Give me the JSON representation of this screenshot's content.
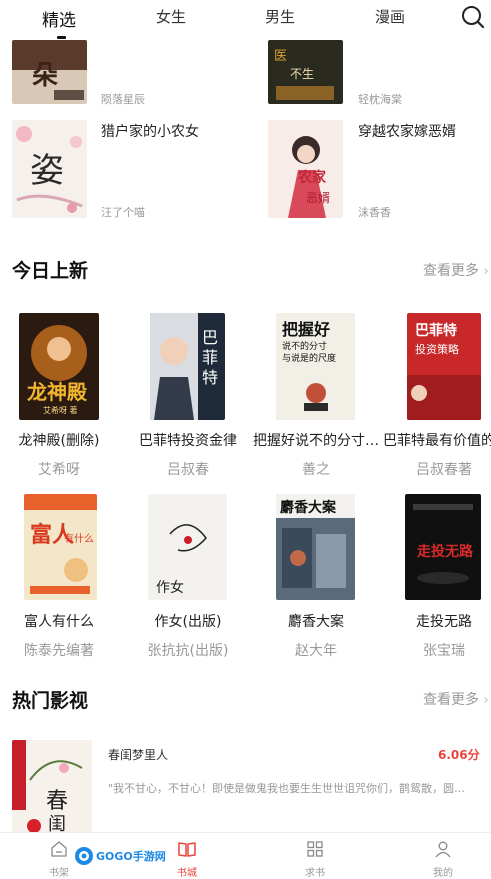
{
  "top_tabs": [
    {
      "label": "精选"
    },
    {
      "label": "女生"
    },
    {
      "label": "男生"
    },
    {
      "label": "漫画"
    }
  ],
  "book_list": [
    {
      "title": "",
      "author": "陨落星辰"
    },
    {
      "title": "",
      "author": "轻枕海棠"
    },
    {
      "title": "猎户家的小农女",
      "author": "汪了个喵"
    },
    {
      "title": "穿越农家嫁恶婿",
      "author": "沫香香"
    }
  ],
  "new_today": {
    "title": "今日上新",
    "more": "查看更多",
    "books": [
      {
        "title": "龙神殿(删除)",
        "author": "艾希呀"
      },
      {
        "title": "巴菲特投资金律",
        "author": "吕叔春"
      },
      {
        "title": "把握好说不的分寸与说是的尺度",
        "author": "善之"
      },
      {
        "title": "巴菲特最有价值的投资策略",
        "author": "吕叔春著"
      },
      {
        "title": "富人有什么",
        "author": "陈泰先编著"
      },
      {
        "title": "作女(出版)",
        "author": "张抗抗(出版)"
      },
      {
        "title": "麝香大案",
        "author": "赵大年"
      },
      {
        "title": "走投无路",
        "author": "张宝瑞"
      }
    ]
  },
  "hot_video": {
    "title": "热门影视",
    "more": "查看更多",
    "items": [
      {
        "title": "春闺梦里人",
        "score": "6.06分",
        "desc": "\"我不甘心，不甘心！即使是做鬼我也要生生世世诅咒你们，鹊鸳散，圆…"
      }
    ]
  },
  "bottom_nav": [
    {
      "label": "书架"
    },
    {
      "label": "书城"
    },
    {
      "label": "求书"
    },
    {
      "label": "我的"
    }
  ],
  "colors": {
    "accent": "#e8453c",
    "muted": "#999999"
  }
}
